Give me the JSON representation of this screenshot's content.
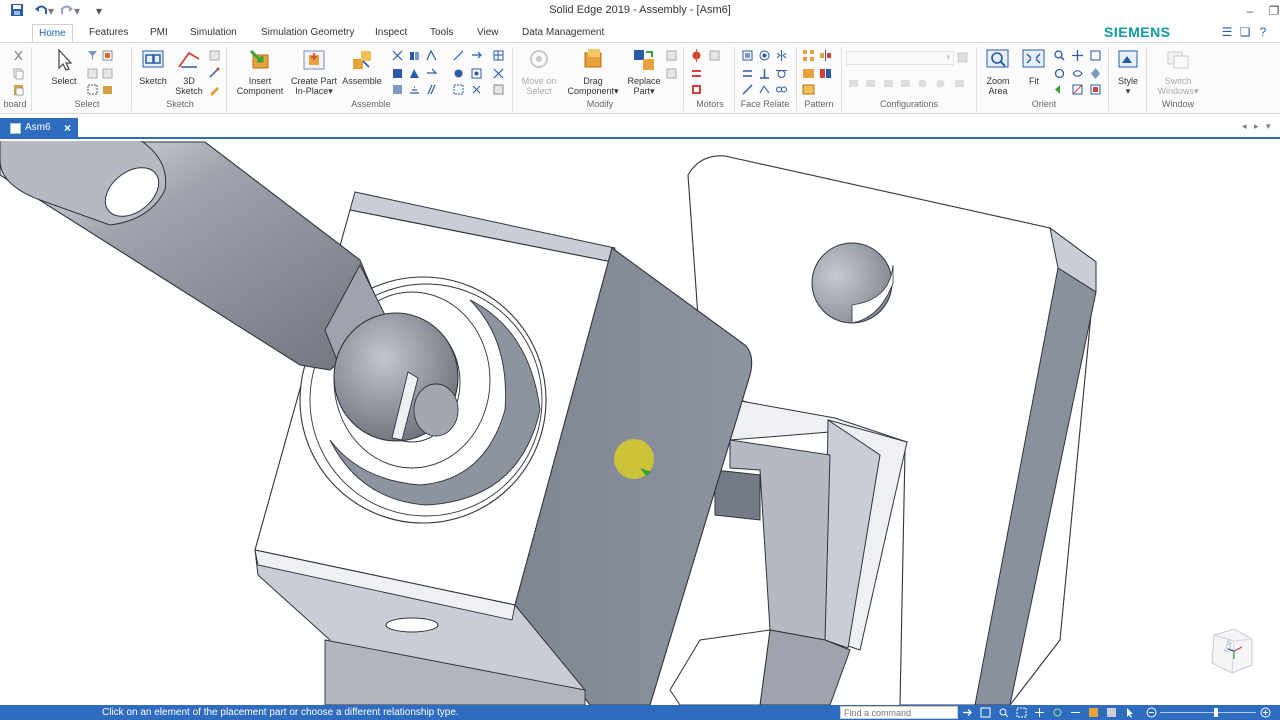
{
  "window": {
    "title": "Solid Edge 2019 - Assembly - [Asm6]",
    "brand": "SIEMENS"
  },
  "quick_access": [
    "save-icon",
    "undo-icon",
    "redo-icon",
    "customize-icon"
  ],
  "menu_tabs": [
    {
      "label": "Home",
      "active": true
    },
    {
      "label": "Features",
      "active": false
    },
    {
      "label": "PMI",
      "active": false
    },
    {
      "label": "Simulation",
      "active": false
    },
    {
      "label": "Simulation Geometry",
      "active": false
    },
    {
      "label": "Inspect",
      "active": false
    },
    {
      "label": "Tools",
      "active": false
    },
    {
      "label": "View",
      "active": false
    },
    {
      "label": "Data Management",
      "active": false
    }
  ],
  "ribbon": {
    "groups": {
      "clipboard": "board",
      "select": "Select",
      "sketch": "Sketch",
      "assemble": "Assemble",
      "modify": "Modify",
      "motors": "Motors",
      "face_relate": "Face Relate",
      "pattern": "Pattern",
      "configurations": "Configurations",
      "orient": "Orient",
      "window": "Window"
    },
    "buttons": {
      "select": "Select",
      "sketch": "Sketch",
      "sketch3d_1": "3D",
      "sketch3d_2": "Sketch",
      "insert_1": "Insert",
      "insert_2": "Component",
      "create_1": "Create Part",
      "create_2": "In-Place",
      "assemble": "Assemble",
      "move_1": "Move on",
      "move_2": "Select",
      "drag_1": "Drag",
      "drag_2": "Component",
      "replace_1": "Replace",
      "replace_2": "Part",
      "zoom_1": "Zoom",
      "zoom_2": "Area",
      "fit": "Fit",
      "style": "Style",
      "switch_1": "Switch",
      "switch_2": "Windows"
    }
  },
  "document_tab": {
    "label": "Asm6"
  },
  "viewport": {
    "view_cube_label": "TOP",
    "colors": {
      "part_face": "#c9ced6",
      "part_dark": "#8a909c",
      "part_light": "#eef0f3",
      "edge": "#3d4350",
      "highlight": "#d8cd2a"
    }
  },
  "statusbar": {
    "prompt": "Click on an element of the placement part or choose a different relationship type.",
    "command_placeholder": "Find a command"
  }
}
